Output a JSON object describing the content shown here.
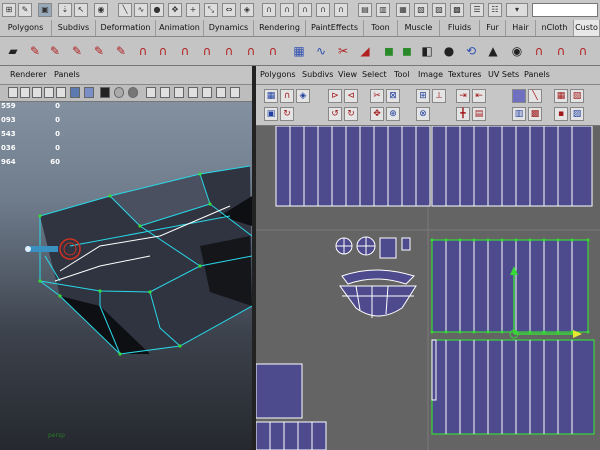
{
  "top_toolbar": {
    "icons": [
      "row-icon-1",
      "row-icon-2",
      "row-icon-3",
      "row-icon-4",
      "row-icon-5",
      "row-icon-6",
      "row-icon-7",
      "row-icon-8",
      "row-icon-9",
      "row-icon-10",
      "row-icon-11",
      "row-icon-12",
      "row-icon-13",
      "row-icon-14",
      "row-icon-15",
      "row-icon-16",
      "row-icon-17",
      "row-icon-18",
      "row-icon-19",
      "row-icon-20",
      "row-icon-21",
      "row-icon-22",
      "row-icon-23",
      "row-icon-24",
      "row-icon-25",
      "row-icon-26",
      "row-icon-27",
      "row-icon-28",
      "row-icon-29",
      "row-icon-30",
      "row-icon-31",
      "row-icon-32",
      "row-icon-33",
      "row-icon-34",
      "row-icon-35"
    ]
  },
  "shelf_tabs": [
    {
      "label": "Polygons"
    },
    {
      "label": "Subdivs"
    },
    {
      "label": "Deformation"
    },
    {
      "label": "Animation"
    },
    {
      "label": "Dynamics"
    },
    {
      "label": "Rendering"
    },
    {
      "label": "PaintEffects"
    },
    {
      "label": "Toon"
    },
    {
      "label": "Muscle"
    },
    {
      "label": "Fluids"
    },
    {
      "label": "Fur"
    },
    {
      "label": "Hair"
    },
    {
      "label": "nCloth"
    },
    {
      "label": "Custo"
    }
  ],
  "left_panel": {
    "menu": [
      "Renderer",
      "Panels"
    ],
    "stats": [
      {
        "a": "559",
        "b": "0"
      },
      {
        "a": "093",
        "b": "0"
      },
      {
        "a": "543",
        "b": "0"
      },
      {
        "a": "036",
        "b": "0"
      },
      {
        "a": "964",
        "b": "60"
      }
    ]
  },
  "right_panel": {
    "menu": [
      "Polygons",
      "Subdivs",
      "View",
      "Select",
      "Tool",
      "Image",
      "Textures",
      "UV Sets",
      "Panels"
    ]
  },
  "colors": {
    "uv_fill": "#4e4a8e",
    "uv_wire": "#ffffff",
    "selected_edge": "#38d838",
    "mesh_wire": "#28d8e8"
  }
}
